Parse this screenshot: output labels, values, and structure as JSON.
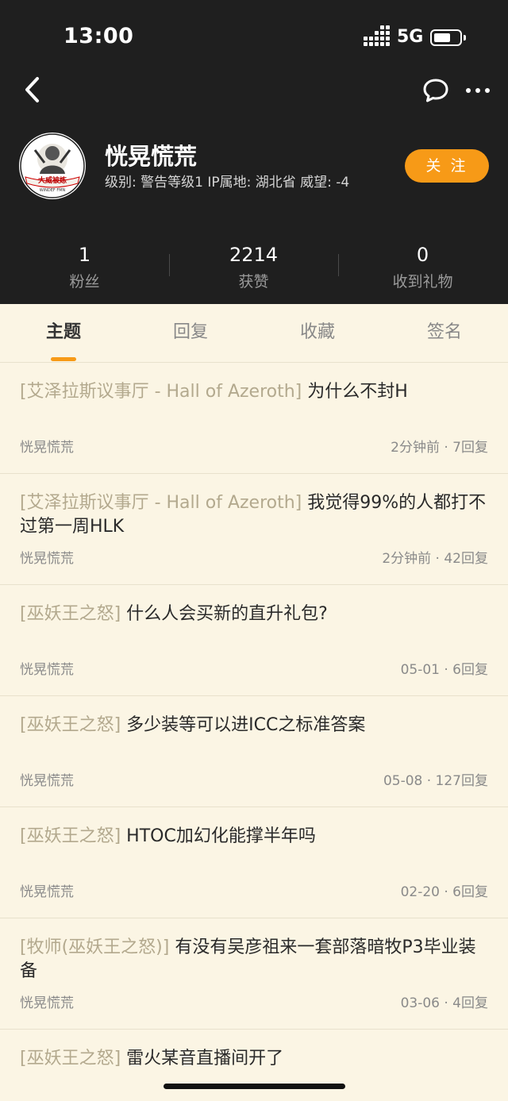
{
  "status_bar": {
    "time": "13:00",
    "network": "5G"
  },
  "profile": {
    "name": "恍晃慌荒",
    "meta": "级别: 警告等级1  IP属地: 湖北省  威望: -4",
    "follow_label": "关 注",
    "avatar_text": "大威被炼",
    "avatar_subtext": "WINDEF FMN"
  },
  "stats": [
    {
      "value": "1",
      "label": "粉丝"
    },
    {
      "value": "2214",
      "label": "获赞"
    },
    {
      "value": "0",
      "label": "收到礼物"
    }
  ],
  "tabs": [
    {
      "label": "主题",
      "active": true
    },
    {
      "label": "回复",
      "active": false
    },
    {
      "label": "收藏",
      "active": false
    },
    {
      "label": "签名",
      "active": false
    }
  ],
  "posts": [
    {
      "forum": "[艾泽拉斯议事厅 - Hall of Azeroth]",
      "title": "为什么不封H",
      "author": "恍晃慌荒",
      "info": "2分钟前 · 7回复"
    },
    {
      "forum": "[艾泽拉斯议事厅 - Hall of Azeroth]",
      "title": "我觉得99%的人都打不过第一周HLK",
      "author": "恍晃慌荒",
      "info": "2分钟前 · 42回复"
    },
    {
      "forum": "[巫妖王之怒]",
      "title": "什么人会买新的直升礼包?",
      "author": "恍晃慌荒",
      "info": "05-01 · 6回复"
    },
    {
      "forum": "[巫妖王之怒]",
      "title": "多少装等可以进ICC之标准答案",
      "author": "恍晃慌荒",
      "info": "05-08 · 127回复"
    },
    {
      "forum": "[巫妖王之怒]",
      "title": "HTOC加幻化能撑半年吗",
      "author": "恍晃慌荒",
      "info": "02-20 · 6回复"
    },
    {
      "forum": "[牧师(巫妖王之怒)]",
      "title": "有没有吴彦祖来一套部落暗牧P3毕业装备",
      "author": "恍晃慌荒",
      "info": "03-06 · 4回复"
    },
    {
      "forum": "[巫妖王之怒]",
      "title": "雷火某音直播间开了",
      "author": "",
      "info": ""
    }
  ],
  "colors": {
    "accent": "#f79a17",
    "header_bg": "#1f1f1f",
    "page_bg": "#fbf5e4",
    "forum_tag": "#b3a98e"
  }
}
